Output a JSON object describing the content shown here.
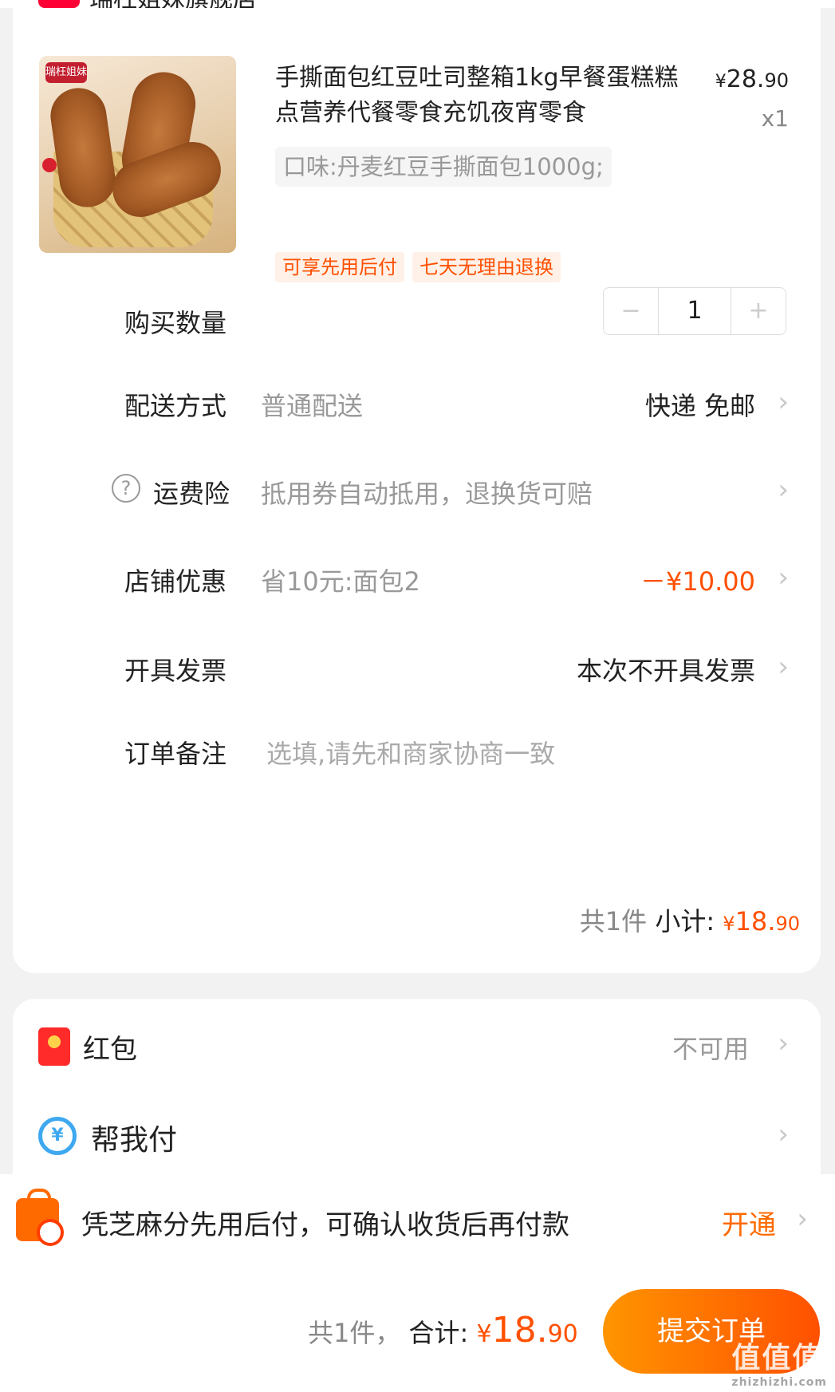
{
  "store": {
    "badge": "天猫",
    "name": "瑞枉姐妹旗舰店"
  },
  "product": {
    "logo": "瑞枉姐妹",
    "title": "手撕面包红豆吐司整箱1kg早餐蛋糕糕点营养代餐零食充饥夜宵零食",
    "price_yen": "¥",
    "price_int": "28.",
    "price_dec": "90",
    "quantity_label": "x1",
    "spec": "口味:丹麦红豆手撕面包1000g;",
    "tags": [
      "可享先用后付",
      "七天无理由退换"
    ]
  },
  "rows": {
    "quantity": {
      "label": "购买数量",
      "minus": "−",
      "value": "1",
      "plus": "+"
    },
    "delivery": {
      "label": "配送方式",
      "sub": "普通配送",
      "value": "快递 免邮"
    },
    "insurance": {
      "icon": "?",
      "label": "运费险",
      "sub": "抵用券自动抵用，退换货可赔"
    },
    "discount": {
      "label": "店铺优惠",
      "sub": "省10元:面包2",
      "value": "－¥10.00"
    },
    "invoice": {
      "label": "开具发票",
      "value": "本次不开具发票"
    },
    "note": {
      "label": "订单备注",
      "placeholder": "选填,请先和商家协商一致"
    }
  },
  "subtotal": {
    "count": "共1件",
    "label": "小计:",
    "yen": "¥",
    "int": "18.",
    "dec": "90"
  },
  "payments": {
    "redpacket": {
      "label": "红包",
      "value": "不可用"
    },
    "helppay": {
      "icon": "¥",
      "label": "帮我付"
    }
  },
  "bnpl": {
    "text": "凭芝麻分先用后付，可确认收货后再付款",
    "action": "开通"
  },
  "footer": {
    "count": "共1件，",
    "total_label": "合计:",
    "yen": "¥",
    "int": "18.",
    "dec": "90",
    "submit": "提交订单",
    "watermark": "值值值",
    "watermark_url": "zhizhizhi.com"
  },
  "chevron": "›",
  "colors": {
    "accent": "#ff5000",
    "tag_bg": "#fff1e8",
    "submit_start": "#ff9500",
    "submit_end": "#ff5000"
  }
}
